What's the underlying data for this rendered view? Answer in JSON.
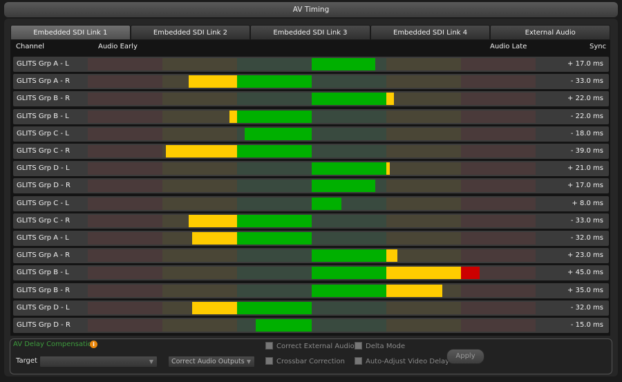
{
  "window": {
    "title": "AV Timing"
  },
  "tabs": [
    {
      "label": "Embedded SDI Link 1",
      "active": true
    },
    {
      "label": "Embedded SDI Link 2",
      "active": false
    },
    {
      "label": "Embedded SDI Link 3",
      "active": false
    },
    {
      "label": "Embedded SDI Link 4",
      "active": false
    },
    {
      "label": "External Audio",
      "active": false
    }
  ],
  "table": {
    "headers": {
      "channel": "Channel",
      "early": "Audio Early",
      "late": "Audio Late",
      "sync": "Sync"
    },
    "rows": [
      {
        "channel": "GLITS Grp A - L",
        "sync": "+ 17.0 ms",
        "value": 17.0
      },
      {
        "channel": "GLITS Grp A - R",
        "sync": "- 33.0 ms",
        "value": -33.0
      },
      {
        "channel": "GLITS Grp B - R",
        "sync": "+ 22.0 ms",
        "value": 22.0
      },
      {
        "channel": "GLITS Grp B - L",
        "sync": "- 22.0 ms",
        "value": -22.0
      },
      {
        "channel": "GLITS Grp C - L",
        "sync": "- 18.0 ms",
        "value": -18.0
      },
      {
        "channel": "GLITS Grp C - R",
        "sync": "- 39.0 ms",
        "value": -39.0
      },
      {
        "channel": "GLITS Grp D - L",
        "sync": "+ 21.0 ms",
        "value": 21.0
      },
      {
        "channel": "GLITS Grp D - R",
        "sync": "+ 17.0 ms",
        "value": 17.0
      },
      {
        "channel": "GLITS Grp C - L",
        "sync": "+ 8.0 ms",
        "value": 8.0
      },
      {
        "channel": "GLITS Grp C - R",
        "sync": "- 33.0 ms",
        "value": -33.0
      },
      {
        "channel": "GLITS Grp A - L",
        "sync": "- 32.0 ms",
        "value": -32.0
      },
      {
        "channel": "GLITS Grp A - R",
        "sync": "+ 23.0 ms",
        "value": 23.0
      },
      {
        "channel": "GLITS Grp B - L",
        "sync": "+ 45.0 ms",
        "value": 45.0
      },
      {
        "channel": "GLITS Grp B - R",
        "sync": "+ 35.0 ms",
        "value": 35.0
      },
      {
        "channel": "GLITS Grp D - L",
        "sync": "- 32.0 ms",
        "value": -32.0
      },
      {
        "channel": "GLITS Grp D - R",
        "sync": "- 15.0 ms",
        "value": -15.0
      }
    ]
  },
  "meter": {
    "range_ms": [
      -60,
      60
    ],
    "zones": [
      {
        "from": -60,
        "to": -40,
        "color": "#4a3a3a",
        "fill": "#cc0000"
      },
      {
        "from": -40,
        "to": -20,
        "color": "#4a4636",
        "fill": "#ffcc00"
      },
      {
        "from": -20,
        "to": 0,
        "color": "#394a3f",
        "fill": "#00b000"
      },
      {
        "from": 0,
        "to": 20,
        "color": "#394a3f",
        "fill": "#00b000"
      },
      {
        "from": 20,
        "to": 40,
        "color": "#4a4636",
        "fill": "#ffcc00"
      },
      {
        "from": 40,
        "to": 60,
        "color": "#4a3a3a",
        "fill": "#cc0000"
      }
    ]
  },
  "controls": {
    "av_delay_label": "AV Delay Compensation",
    "info_icon": "i",
    "target_label": "Target",
    "target_value": "",
    "correct_outputs_value": "Correct Audio Outputs",
    "checkboxes": [
      {
        "label": "Correct External Audio"
      },
      {
        "label": "Crossbar Correction"
      },
      {
        "label": "Delta Mode"
      },
      {
        "label": "Auto-Adjust Video Delay"
      }
    ],
    "apply_label": "Apply"
  }
}
